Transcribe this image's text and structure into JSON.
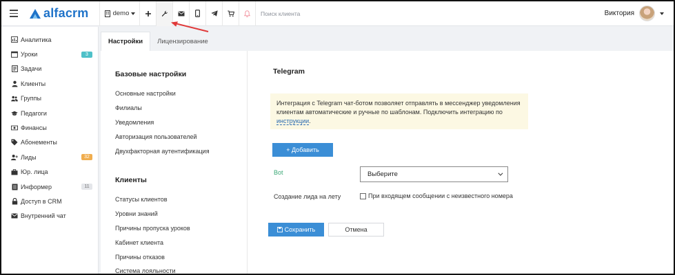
{
  "header": {
    "logo_text": "alfacrm",
    "branch_label": "demo",
    "search_placeholder": "Поиск клиента",
    "user_name": "Виктория",
    "tools": [
      "plus-icon",
      "wrench-icon",
      "envelope-icon",
      "phone-icon",
      "telegram-icon",
      "cart-icon",
      "bell-icon"
    ]
  },
  "sidebar": {
    "items": [
      {
        "label": "Аналитика",
        "icon": "analytics-icon"
      },
      {
        "label": "Уроки",
        "icon": "calendar-icon",
        "badge": "3",
        "badge_color": "#4fc1c9"
      },
      {
        "label": "Задачи",
        "icon": "tasks-icon"
      },
      {
        "label": "Клиенты",
        "icon": "user-icon"
      },
      {
        "label": "Группы",
        "icon": "group-icon"
      },
      {
        "label": "Педагоги",
        "icon": "graduation-cap-icon"
      },
      {
        "label": "Финансы",
        "icon": "money-icon"
      },
      {
        "label": "Абонементы",
        "icon": "tag-icon"
      },
      {
        "label": "Лиды",
        "icon": "user-plus-icon",
        "badge": "32",
        "badge_color": "#f0ad4e"
      },
      {
        "label": "Юр. лица",
        "icon": "briefcase-icon"
      },
      {
        "label": "Информер",
        "icon": "informer-icon",
        "badge": "11",
        "badge_color": "#e4e6ea",
        "badge_text_color": "#777"
      },
      {
        "label": "Доступ в CRM",
        "icon": "lock-icon"
      },
      {
        "label": "Внутренний чат",
        "icon": "chat-icon"
      }
    ]
  },
  "tabs": [
    {
      "label": "Настройки",
      "active": true
    },
    {
      "label": "Лицензирование",
      "active": false
    }
  ],
  "settings_nav": {
    "basic_title": "Базовые настройки",
    "basic_items": [
      "Основные настройки",
      "Филиалы",
      "Уведомления",
      "Авторизация пользователей",
      "Двухфакторная аутентификация"
    ],
    "clients_title": "Клиенты",
    "clients_items": [
      "Статусы клиентов",
      "Уровни знаний",
      "Причины пропуска уроков",
      "Кабинет клиента",
      "Причины отказов",
      "Система лояльности"
    ]
  },
  "telegram": {
    "title": "Telegram",
    "info_text": "Интеграция с Telegram чат-ботом позволяет отправлять в мессенджер уведомления клиентам автоматические и ручные по шаблонам. Подключить интеграцию по ",
    "info_link": "инструкции",
    "info_end": ".",
    "add_button": "+ Добавить",
    "bot_label": "Bot",
    "bot_select_value": "Выберите",
    "lead_label": "Создание лида на лету",
    "checkbox_label": "При входящем сообщении с неизвестного номера",
    "save_button": "Сохранить",
    "cancel_button": "Отмена"
  },
  "colors": {
    "accent": "#3b8ed6",
    "logo": "#1f73c9",
    "info_bg": "#fcf8e3",
    "annotation_arrow": "#e03a3a"
  }
}
